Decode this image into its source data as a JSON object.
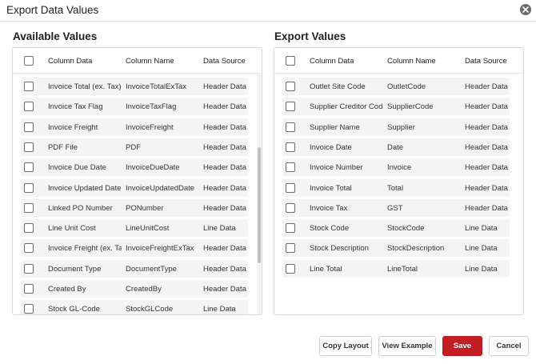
{
  "dialog": {
    "title": "Export Data Values"
  },
  "available": {
    "title": "Available Values",
    "headers": {
      "column_data": "Column Data",
      "column_name": "Column Name",
      "data_source": "Data Source"
    },
    "rows": [
      {
        "column_data": "Invoice Total (ex. Tax)",
        "column_name": "InvoiceTotalExTax",
        "data_source": "Header Data"
      },
      {
        "column_data": "Invoice Tax Flag",
        "column_name": "InvoiceTaxFlag",
        "data_source": "Header Data"
      },
      {
        "column_data": "Invoice Freight",
        "column_name": "InvoiceFreight",
        "data_source": "Header Data"
      },
      {
        "column_data": "PDF File",
        "column_name": "PDF",
        "data_source": "Header Data"
      },
      {
        "column_data": "Invoice Due Date",
        "column_name": "InvoiceDueDate",
        "data_source": "Header Data"
      },
      {
        "column_data": "Invoice Updated Date",
        "column_name": "InvoiceUpdatedDate",
        "data_source": "Header Data"
      },
      {
        "column_data": "Linked PO Number",
        "column_name": "PONumber",
        "data_source": "Header Data"
      },
      {
        "column_data": "Line Unit Cost",
        "column_name": "LineUnitCost",
        "data_source": "Line Data"
      },
      {
        "column_data": "Invoice Freight (ex. Ta...",
        "column_name": "InvoiceFreightExTax",
        "data_source": "Header Data"
      },
      {
        "column_data": "Document Type",
        "column_name": "DocumentType",
        "data_source": "Header Data"
      },
      {
        "column_data": "Created By",
        "column_name": "CreatedBy",
        "data_source": "Header Data"
      },
      {
        "column_data": "Stock GL-Code",
        "column_name": "StockGLCode",
        "data_source": "Line Data"
      }
    ]
  },
  "export": {
    "title": "Export Values",
    "headers": {
      "column_data": "Column Data",
      "column_name": "Column Name",
      "data_source": "Data Source"
    },
    "rows": [
      {
        "column_data": "Outlet Site Code",
        "column_name": "OutletCode",
        "data_source": "Header Data"
      },
      {
        "column_data": "Supplier Creditor Code",
        "column_name": "SupplierCode",
        "data_source": "Header Data"
      },
      {
        "column_data": "Supplier Name",
        "column_name": "Supplier",
        "data_source": "Header Data"
      },
      {
        "column_data": "Invoice Date",
        "column_name": "Date",
        "data_source": "Header Data"
      },
      {
        "column_data": "Invoice Number",
        "column_name": "Invoice",
        "data_source": "Header Data"
      },
      {
        "column_data": "Invoice Total",
        "column_name": "Total",
        "data_source": "Header Data"
      },
      {
        "column_data": "Invoice Tax",
        "column_name": "GST",
        "data_source": "Header Data"
      },
      {
        "column_data": "Stock Code",
        "column_name": "StockCode",
        "data_source": "Line Data"
      },
      {
        "column_data": "Stock Description",
        "column_name": "StockDescription",
        "data_source": "Line Data"
      },
      {
        "column_data": "Line Total",
        "column_name": "LineTotal",
        "data_source": "Line Data"
      }
    ]
  },
  "buttons": {
    "copy_layout": "Copy Layout",
    "view_example": "View Example",
    "save": "Save",
    "cancel": "Cancel"
  },
  "colors": {
    "save": "#c41e24",
    "close_icon_bg": "#6a6a6a",
    "row_bg": "#f4f4f4",
    "border": "#d9d9d9"
  },
  "icons": {
    "close": "close-icon",
    "checkbox": "checkbox-icon"
  }
}
